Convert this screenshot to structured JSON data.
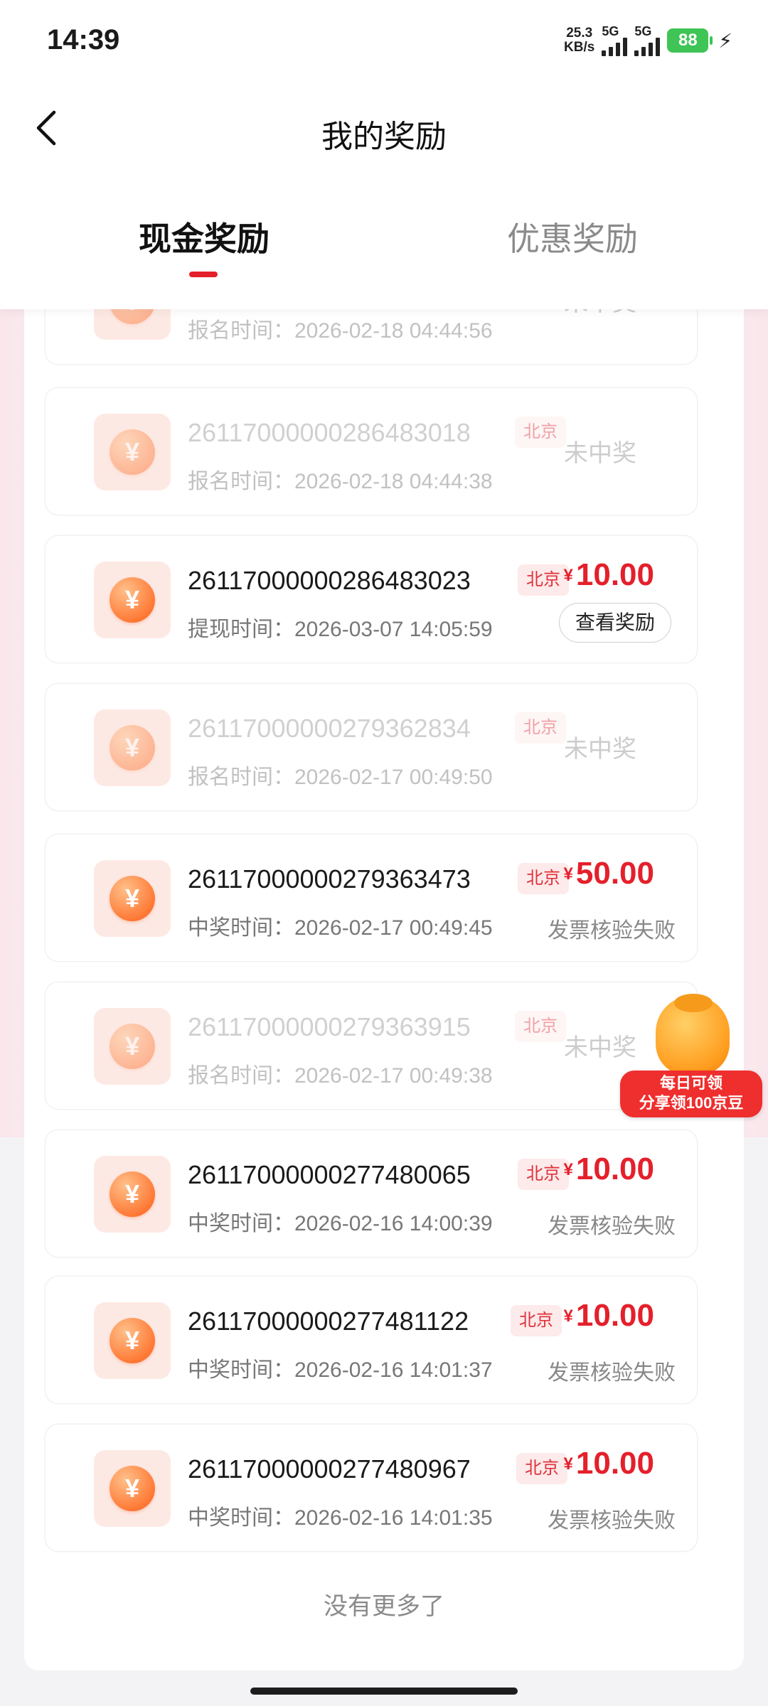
{
  "status_bar": {
    "time": "14:39",
    "net_speed_value": "25.3",
    "net_speed_unit": "KB/s",
    "network_1": "5G",
    "network_2": "5G",
    "battery": "88"
  },
  "header": {
    "title": "我的奖励",
    "tabs": [
      {
        "label": "现金奖励",
        "active": true
      },
      {
        "label": "优惠奖励",
        "active": false
      }
    ]
  },
  "colors": {
    "accent": "#e4202b",
    "coin": "#ff7a36",
    "battery": "#3fc456"
  },
  "rewards": [
    {
      "id": "",
      "city": "",
      "time": "报名时间：2026-02-18 04:44:56",
      "status": "未中奖",
      "dim": true,
      "partial": true
    },
    {
      "id": "26117000000286483018",
      "city": "北京",
      "time": "报名时间：2026-02-18 04:44:38",
      "status": "未中奖",
      "dim": true
    },
    {
      "id": "26117000000286483023",
      "city": "北京",
      "time": "提现时间：2026-03-07 14:05:59",
      "currency": "¥",
      "amount": "10.00",
      "action": "查看奖励"
    },
    {
      "id": "26117000000279362834",
      "city": "北京",
      "time": "报名时间：2026-02-17 00:49:50",
      "status": "未中奖",
      "dim": true
    },
    {
      "id": "26117000000279363473",
      "city": "北京",
      "time": "中奖时间：2026-02-17 00:49:45",
      "currency": "¥",
      "amount": "50.00",
      "note": "发票核验失败"
    },
    {
      "id": "26117000000279363915",
      "city": "北京",
      "time": "报名时间：2026-02-17 00:49:38",
      "status": "未中奖",
      "dim": true
    },
    {
      "id": "26117000000277480065",
      "city": "北京",
      "time": "中奖时间：2026-02-16 14:00:39",
      "currency": "¥",
      "amount": "10.00",
      "note": "发票核验失败"
    },
    {
      "id": "26117000000277481122",
      "city": "北京",
      "time": "中奖时间：2026-02-16 14:01:37",
      "currency": "¥",
      "amount": "10.00",
      "note": "发票核验失败"
    },
    {
      "id": "26117000000277480967",
      "city": "北京",
      "time": "中奖时间：2026-02-16 14:01:35",
      "currency": "¥",
      "amount": "10.00",
      "note": "发票核验失败"
    }
  ],
  "footer": {
    "no_more": "没有更多了"
  },
  "promo": {
    "line1": "每日可领",
    "line2": "分享领100京豆"
  }
}
